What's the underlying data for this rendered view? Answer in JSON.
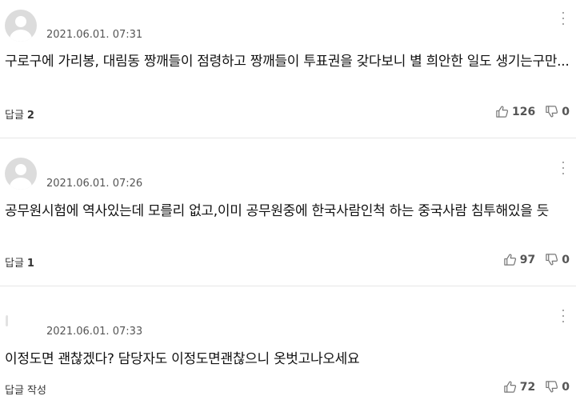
{
  "comments": [
    {
      "timestamp": "2021.06.01. 07:31",
      "text": "구로구에 가리봉, 대림동 짱깨들이 점령하고 짱깨들이 투표권을 갖다보니 별 희안한 일도 생기는구만...",
      "reply_label": "답글",
      "reply_count": "2",
      "likes": "126",
      "dislikes": "0",
      "avatar": "default-profile"
    },
    {
      "timestamp": "2021.06.01. 07:26",
      "text": "공무원시험에 역사있는데 모를리 없고,이미 공무원중에 한국사람인척 하는 중국사람 침투해있을 듯",
      "reply_label": "답글",
      "reply_count": "1",
      "likes": "97",
      "dislikes": "0",
      "avatar": "default-profile"
    },
    {
      "timestamp": "2021.06.01. 07:33",
      "text": "이정도면 괜찮겠다? 담당자도 이정도면괜찮으니 옷벗고나오세요",
      "reply_label": "답글 작성",
      "reply_count": "",
      "likes": "72",
      "dislikes": "0",
      "avatar": "blank"
    }
  ],
  "icons": {
    "more": "more-vertical-icon",
    "like": "thumbs-up-icon",
    "dislike": "thumbs-down-icon"
  },
  "colors": {
    "text": "#111111",
    "meta": "#555555",
    "divider": "#e6e6e6",
    "avatar_bg": "#dcdcdc"
  }
}
